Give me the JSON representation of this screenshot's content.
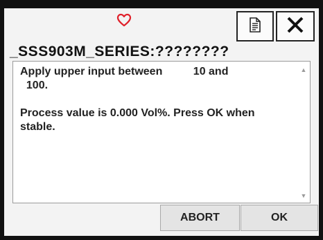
{
  "header": {
    "title": "_SSS903M_SERIES:????????",
    "heart_icon": "heart-outline-icon",
    "doc_icon": "document-icon",
    "close_icon": "close-icon"
  },
  "message": {
    "lines": [
      "Apply upper input between          10 and",
      "  100.",
      "",
      "Process value is 0.000 Vol%. Press OK when",
      "stable."
    ]
  },
  "buttons": {
    "abort": "ABORT",
    "ok": "OK"
  },
  "colors": {
    "heart": "#e0202a",
    "frame": "#111111",
    "background": "#f3f3f3"
  }
}
